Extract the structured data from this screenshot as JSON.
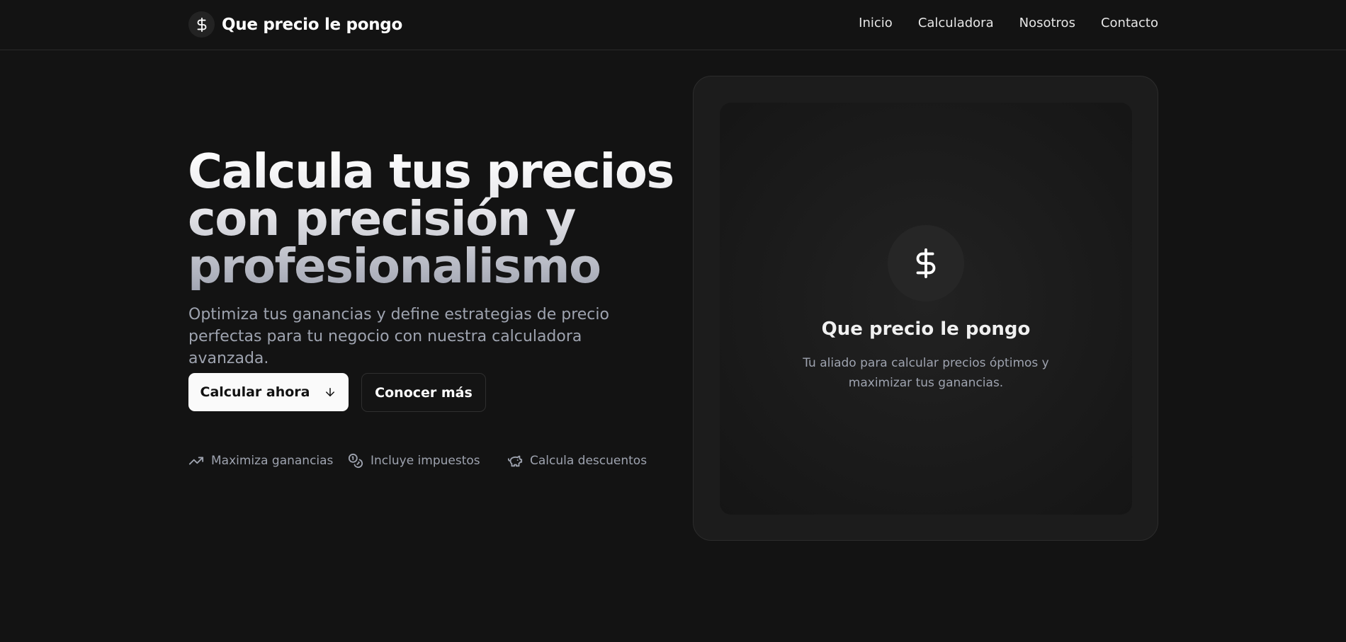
{
  "brand": {
    "title": "Que precio le pongo",
    "icon": "dollar-sign-icon"
  },
  "nav": {
    "items": [
      {
        "label": "Inicio"
      },
      {
        "label": "Calculadora"
      },
      {
        "label": "Nosotros"
      },
      {
        "label": "Contacto"
      }
    ]
  },
  "hero": {
    "title": "Calcula tus precios con precisión y profesionalismo",
    "subtitle": "Optimiza tus ganancias y define estrategias de precio perfectas para tu negocio con nuestra calculadora avanzada.",
    "primary_button": "Calcular ahora",
    "primary_button_icon": "arrow-down-icon",
    "secondary_button": "Conocer más",
    "features": [
      {
        "label": "Maximiza ganancias",
        "icon": "trending-up-icon"
      },
      {
        "label": "Incluye impuestos",
        "icon": "coins-icon"
      },
      {
        "label": "Calcula descuentos",
        "icon": "piggy-bank-icon"
      }
    ]
  },
  "card": {
    "icon": "dollar-sign-icon",
    "title": "Que precio le pongo",
    "description": "Tu aliado para calcular precios óptimos y maximizar tus ganancias."
  },
  "colors": {
    "background": "#131313",
    "card_outer": "#1c1c1c",
    "text_primary": "#ffffff",
    "text_muted": "#9ea3af",
    "button_primary_bg": "#fafafa"
  }
}
